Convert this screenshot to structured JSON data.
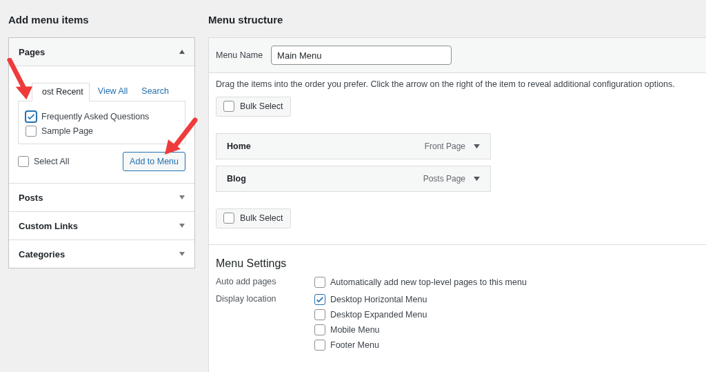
{
  "left": {
    "title": "Add menu items",
    "sections": [
      {
        "title": "Pages",
        "expanded": true,
        "tabs": [
          {
            "label": "ost Recent",
            "selected": true
          },
          {
            "label": "View All",
            "selected": false
          },
          {
            "label": "Search",
            "selected": false
          }
        ],
        "items": [
          {
            "label": "Frequently Asked Questions",
            "checked": true
          },
          {
            "label": "Sample Page",
            "checked": false
          }
        ],
        "select_all": {
          "label": "Select All",
          "checked": false
        },
        "button": "Add to Menu"
      },
      {
        "title": "Posts",
        "expanded": false
      },
      {
        "title": "Custom Links",
        "expanded": false
      },
      {
        "title": "Categories",
        "expanded": false
      }
    ]
  },
  "right": {
    "title": "Menu structure",
    "menu_name": {
      "label": "Menu Name",
      "value": "Main Menu"
    },
    "instructions": "Drag the items into the order you prefer. Click the arrow on the right of the item to reveal additional configuration options.",
    "bulk_select_top": {
      "label": "Bulk Select",
      "checked": false
    },
    "items": [
      {
        "title": "Home",
        "type": "Front Page"
      },
      {
        "title": "Blog",
        "type": "Posts Page"
      }
    ],
    "bulk_select_bottom": {
      "label": "Bulk Select",
      "checked": false
    },
    "settings": {
      "title": "Menu Settings",
      "rows": [
        {
          "label": "Auto add pages",
          "options": [
            {
              "label": "Automatically add new top-level pages to this menu",
              "checked": false
            }
          ]
        },
        {
          "label": "Display location",
          "options": [
            {
              "label": "Desktop Horizontal Menu",
              "checked": true
            },
            {
              "label": "Desktop Expanded Menu",
              "checked": false
            },
            {
              "label": "Mobile Menu",
              "checked": false
            },
            {
              "label": "Footer Menu",
              "checked": false
            }
          ]
        }
      ]
    }
  }
}
